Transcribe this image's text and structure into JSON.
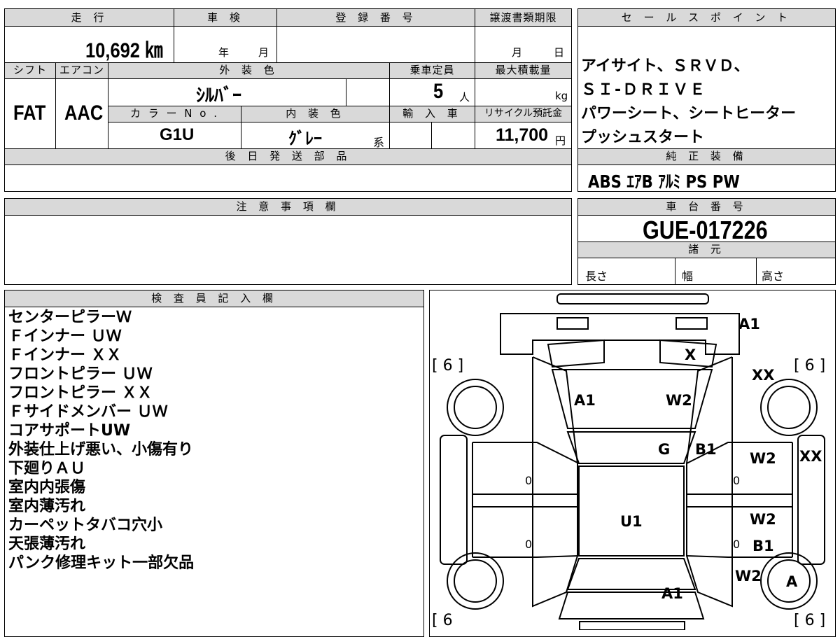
{
  "top_row": {
    "header_mileage": "走 行",
    "header_inspection": "車 検",
    "header_registration": "登 録 番 号",
    "header_transfer_deadline": "譲渡書類期限",
    "mileage": "10,692 ㎞",
    "inspection_year_unit": "年",
    "inspection_month_unit": "月",
    "deadline_month_unit": "月",
    "deadline_day_unit": "日"
  },
  "row2": {
    "header_shift": "シフト",
    "header_aircon": "エアコン",
    "header_exterior_color": "外 装 色",
    "header_capacity": "乗車定員",
    "header_max_load": "最大積載量",
    "shift": "FAT",
    "aircon": "AAC",
    "exterior_color": "ｼﾙﾊﾞｰ",
    "capacity": "5",
    "capacity_unit": "人",
    "load_unit": "kg"
  },
  "row3": {
    "header_color_no": "カ ラ ー N o .",
    "header_interior_color": "内 装 色",
    "header_import": "輸 入 車",
    "header_recycle": "リサイクル預託金",
    "color_no": "G1U",
    "interior_color": "ｸﾞﾚｰ",
    "interior_suffix": "系",
    "recycle_fee": "11,700",
    "recycle_unit": "円"
  },
  "later_parts": {
    "header": "後 日 発 送 部 品"
  },
  "notes": {
    "header": "注 意 事 項 欄"
  },
  "sales_points": {
    "header": "セ ー ル ス ポ イ ン ト",
    "lines": [
      "アイサイト、ＳＲＶＤ、",
      "ＳＩ-ＤＲＩＶＥ",
      "パワーシート、シートヒーター",
      "プッシュスタート"
    ]
  },
  "equipment": {
    "header": "純 正 装 備",
    "items": "ABS ｴｱB ｱﾙﾐ PS PW"
  },
  "chassis": {
    "header": "車 台 番 号",
    "number": "GUE-017226"
  },
  "specs": {
    "header": "諸 元",
    "length": "長さ",
    "width": "幅",
    "height": "高さ"
  },
  "inspector": {
    "header": "検 査 員 記 入 欄",
    "lines": [
      "センターピラーＷ",
      "Ｆインナー ＵＷ",
      "Ｆインナー ＸＸ",
      "フロントピラー ＵＷ",
      "フロントピラー ＸＸ",
      "Ｆサイドメンバー ＵＷ",
      "コアサポートUW",
      "外装仕上げ悪い、小傷有り",
      "下廻りＡＵ",
      "室内内張傷",
      "室内薄汚れ",
      "カーペットタバコ穴小",
      "天張薄汚れ",
      "パンク修理キット一部欠品"
    ]
  },
  "diagram": {
    "tire_left_top": "[ 6 ]",
    "tire_right_top": "[ 6 ]",
    "tire_left_bottom": "[ 6",
    "tire_right_bottom": "[ 6 ]",
    "marks": {
      "a1_top_right": "A1",
      "x_mirror": "X",
      "xx_right": "XX",
      "a1_hood": "A1",
      "w2_hood": "W2",
      "g_windshield": "G",
      "b1_pillar": "B1",
      "w2_right_front": "W2",
      "xx_right_side": "XX",
      "u1_roof": "U1",
      "w2_right_rear": "W2",
      "b1_right_rear": "B1",
      "w2_rear_wheel": "W2",
      "a_rear_tire": "A",
      "a1_trunk": "A1",
      "zero_lf": "0",
      "zero_rf": "0",
      "zero_lr": "0",
      "zero_rr": "0"
    }
  }
}
